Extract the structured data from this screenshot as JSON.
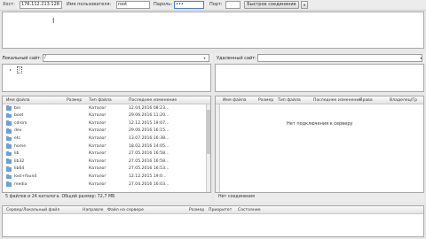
{
  "quickconnect": {
    "host_label": "Хост:",
    "host_value": "176.112.213.128",
    "user_label": "Имя пользователя:",
    "user_value": "root",
    "pass_label": "Пароль:",
    "pass_value": "•••",
    "port_label": "Порт:",
    "port_value": "",
    "connect_button": "Быстрое соединение",
    "dropdown_glyph": "▾"
  },
  "local": {
    "site_label": "Локальный сайт:",
    "path": "/",
    "tree_root": "/",
    "columns": [
      "Имя файла",
      "Размер",
      "Тип файла",
      "Последнее изменение"
    ],
    "files": [
      {
        "name": "bin",
        "type": "Каталог",
        "modified": "12.04.2016 08:23..."
      },
      {
        "name": "boot",
        "type": "Каталог",
        "modified": "29.06.2016 11:20..."
      },
      {
        "name": "cdrom",
        "type": "Каталог",
        "modified": "12.12.2015 19:07..."
      },
      {
        "name": "dev",
        "type": "Каталог",
        "modified": "29.06.2016 16:15..."
      },
      {
        "name": "etc",
        "type": "Каталог",
        "modified": "13.07.2016 16:38..."
      },
      {
        "name": "home",
        "type": "Каталог",
        "modified": "18.02.2016 14:05..."
      },
      {
        "name": "lib",
        "type": "Каталог",
        "modified": "27.05.2016 16:58..."
      },
      {
        "name": "lib32",
        "type": "Каталог",
        "modified": "27.05.2016 16:58..."
      },
      {
        "name": "lib64",
        "type": "Каталог",
        "modified": "27.05.2016 16:53..."
      },
      {
        "name": "lost+found",
        "type": "Каталог",
        "modified": "12.12.2015 19:0..."
      },
      {
        "name": "media",
        "type": "Каталог",
        "modified": "27.04.2016 16:03..."
      }
    ],
    "status": "5 файлов и 24 каталога. Общий размер: 72,7 МБ"
  },
  "remote": {
    "site_label": "Удаленный сайт:",
    "path": "",
    "columns": [
      "Имя файла",
      "Размер",
      "Тип файла",
      "Последнее изменение",
      "Права",
      "Владелец/Гр"
    ],
    "empty_message": "Нет подключения к серверу",
    "status": "Нет соединения"
  },
  "queue": {
    "columns": [
      "Сервер/Локальный файл",
      "Направле",
      "Файл на сервере",
      "Размер",
      "Приоритет",
      "Состояние"
    ]
  }
}
